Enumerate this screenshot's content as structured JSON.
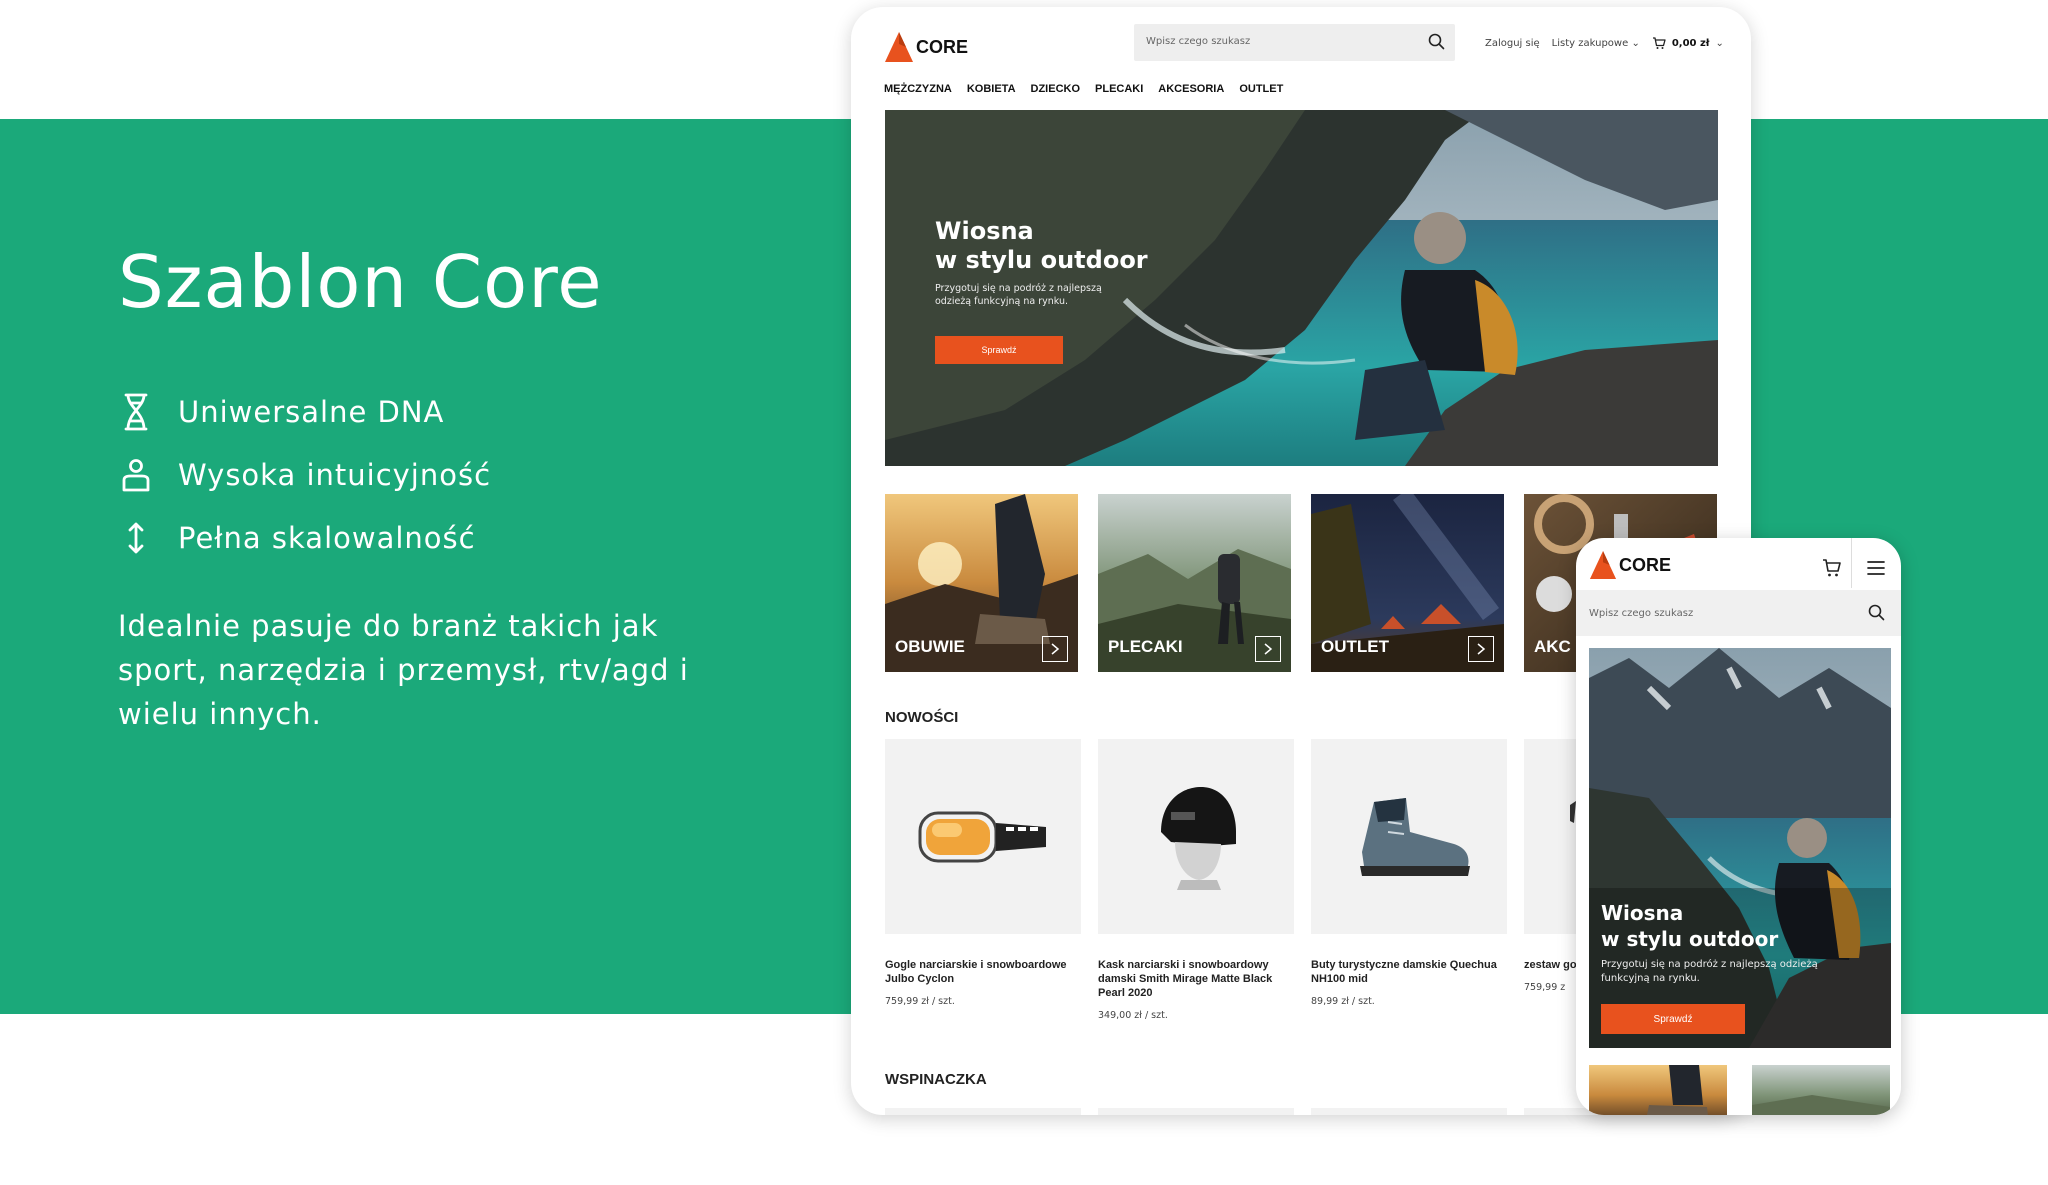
{
  "marketing": {
    "headline": "Szablon Core",
    "features": [
      {
        "icon": "dna-icon",
        "label": "Uniwersalne DNA"
      },
      {
        "icon": "user-intuitive-icon",
        "label": "Wysoka intuicyjność"
      },
      {
        "icon": "vertical-arrows-icon",
        "label": "Pełna skalowalność"
      }
    ],
    "description": "Idealnie pasuje do branż takich jak sport, narzędzia i przemysł, rtv/agd i wielu innych."
  },
  "brand": {
    "name": "CORE",
    "accent_color": "#e8521e",
    "green_color": "#1ba97a"
  },
  "desktop": {
    "search_placeholder": "Wpisz czego szukasz",
    "login": "Zaloguj się",
    "lists": "Listy zakupowe",
    "cart_total": "0,00 zł",
    "nav": [
      "MĘŻCZYZNA",
      "KOBIETA",
      "DZIECKO",
      "PLECAKI",
      "AKCESORIA",
      "OUTLET"
    ],
    "hero": {
      "title_line1": "Wiosna",
      "title_line2": "w stylu outdoor",
      "subtitle": "Przygotuj się na podróż z najlepszą odzieżą funkcyjną na rynku.",
      "button": "Sprawdź"
    },
    "categories": [
      "OBUWIE",
      "PLECAKI",
      "OUTLET",
      "AKC"
    ],
    "section_new": "NOWOŚCI",
    "products": [
      {
        "name": "Gogle narciarskie i snowboardowe Julbo Cyclon",
        "price": "759,99 zł / szt."
      },
      {
        "name": "Kask narciarski i snowboardowy damski Smith Mirage Matte Black Pearl 2020",
        "price": "349,00 zł / szt."
      },
      {
        "name": "Buty turystyczne damskie Quechua NH100 mid",
        "price": "89,99 zł / szt."
      },
      {
        "name": "zestaw go",
        "price": "759,99 z"
      }
    ],
    "section_climbing": "WSPINACZKA"
  },
  "mobile": {
    "search_placeholder": "Wpisz czego szukasz",
    "hero": {
      "title_line1": "Wiosna",
      "title_line2": "w stylu outdoor",
      "subtitle": "Przygotuj się na podróż z najlepszą odzieżą funkcyjną na rynku.",
      "button": "Sprawdź"
    }
  }
}
